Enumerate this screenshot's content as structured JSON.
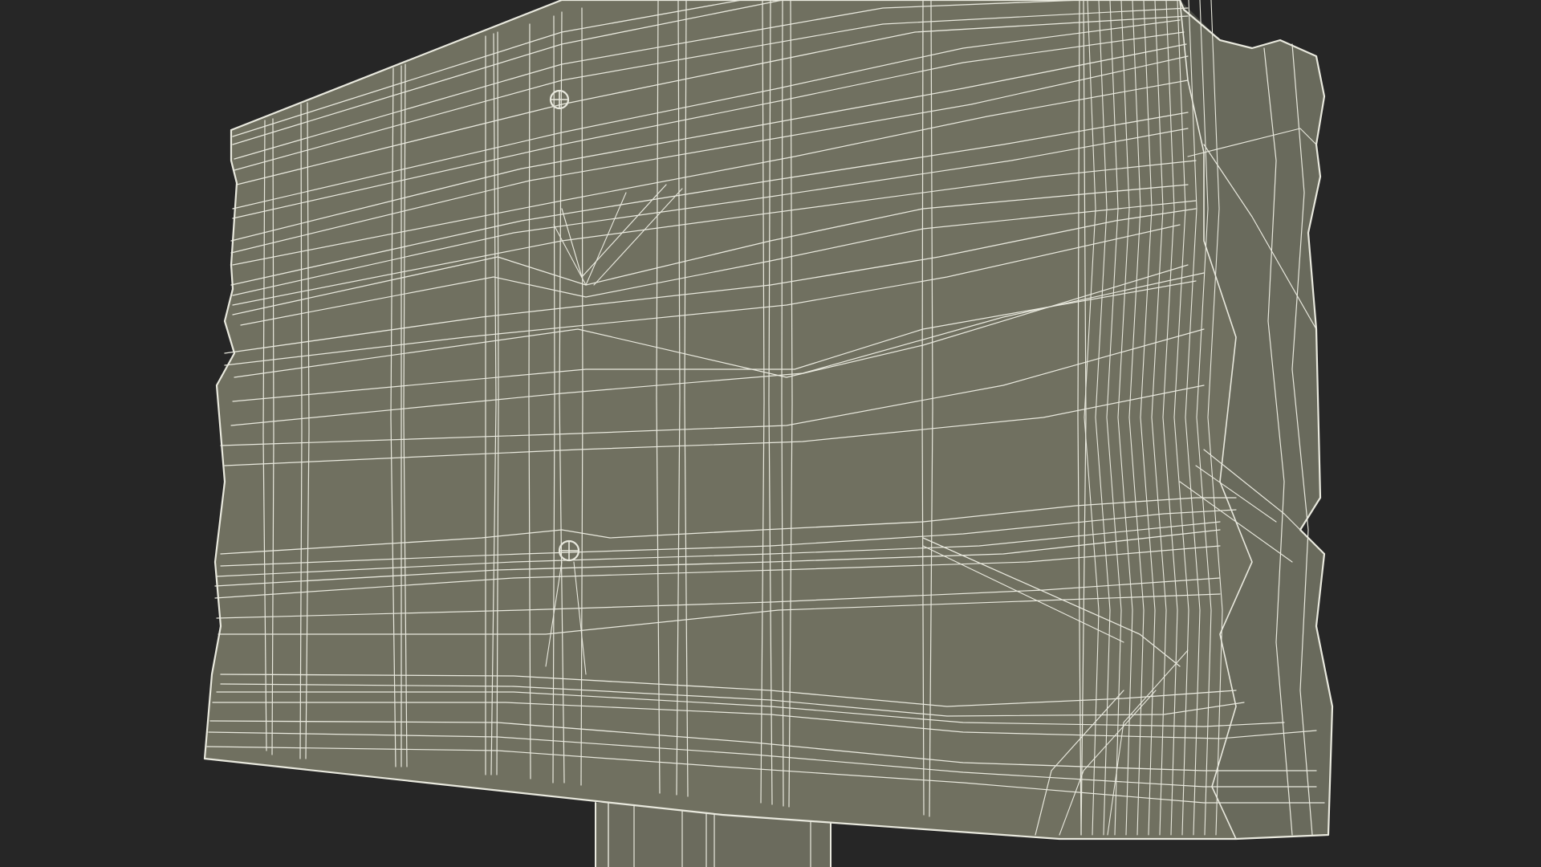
{
  "scene": {
    "subject": "wooden-sign-board-wireframe",
    "background_color": "#262626",
    "surface_color": "#707060",
    "surface_shade_color": "#65665A",
    "wire_color": "#E9E9DE",
    "post_color": "#6B6B5D"
  }
}
